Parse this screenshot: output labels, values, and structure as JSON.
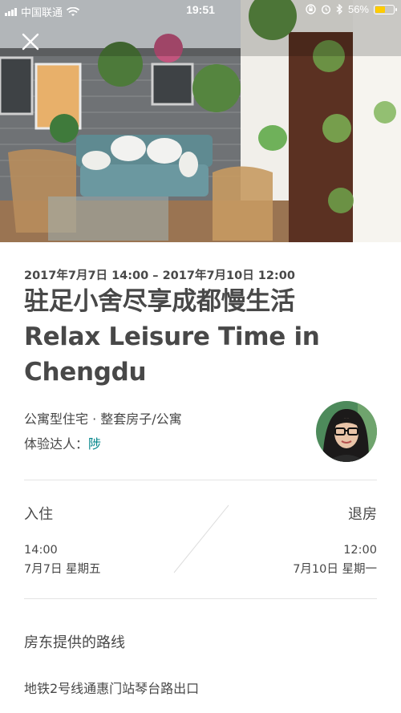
{
  "status_bar": {
    "carrier": "中国联通",
    "time": "19:51",
    "battery_percent": "56%",
    "battery_level": 0.56
  },
  "listing": {
    "date_range": "2017年7月7日 14:00 – 2017年7月10日 12:00",
    "title": "驻足小舍尽享成都慢生活 Relax Leisure Time in Chengdu",
    "property_type": "公寓型住宅 · 整套房子/公寓",
    "host_label": "体验达人：",
    "host_name": "陟"
  },
  "stay": {
    "checkin_label": "入住",
    "checkin_time": "14:00",
    "checkin_date": "7月7日 星期五",
    "checkout_label": "退房",
    "checkout_time": "12:00",
    "checkout_date": "7月10日 星期一"
  },
  "route": {
    "title": "房东提供的路线",
    "text": "地铁2号线通惠门站琴台路出口"
  },
  "colors": {
    "text": "#484848",
    "link": "#008489",
    "divider": "#e4e4e4",
    "battery": "#ffcc00"
  }
}
